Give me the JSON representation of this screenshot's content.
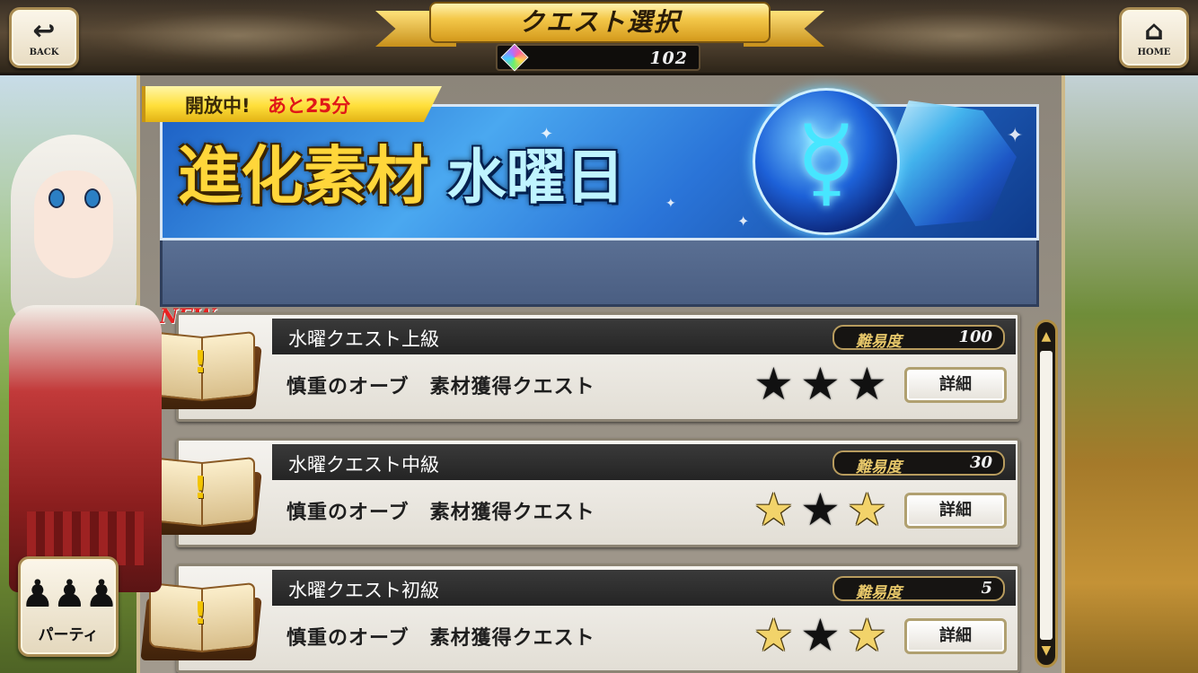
{
  "header": {
    "title": "クエスト選択",
    "back_label": "BACK",
    "home_label": "HOME",
    "gem_count": "102"
  },
  "event": {
    "open_status": "開放中!",
    "time_remaining": "あと25分",
    "title_main": "進化素材",
    "title_day": "水曜日",
    "orb_symbol": "☿"
  },
  "new_label": "NEW",
  "quests": [
    {
      "name": "水曜クエスト上級",
      "difficulty_label": "難易度",
      "difficulty": "100",
      "description": "慎重のオーブ　素材獲得クエスト",
      "stars": [
        "filled",
        "filled",
        "filled"
      ],
      "detail_label": "詳細"
    },
    {
      "name": "水曜クエスト中級",
      "difficulty_label": "難易度",
      "difficulty": "30",
      "description": "慎重のオーブ　素材獲得クエスト",
      "stars": [
        "gold",
        "filled",
        "gold"
      ],
      "detail_label": "詳細"
    },
    {
      "name": "水曜クエスト初級",
      "difficulty_label": "難易度",
      "difficulty": "5",
      "description": "慎重のオーブ　素材獲得クエスト",
      "stars": [
        "gold",
        "filled",
        "gold"
      ],
      "detail_label": "詳細"
    }
  ],
  "party": {
    "label": "パーティ"
  },
  "icons": {
    "back": "back-arrow-icon",
    "home": "home-icon",
    "gem": "rainbow-gem-icon",
    "book": "quest-book-icon",
    "star": "star-icon",
    "party": "party-members-icon"
  },
  "colors": {
    "title_gold": "#f4c84a",
    "event_blue": "#2a74d8",
    "open_tag_yellow": "#ffdf3a",
    "time_red": "#e01818",
    "header_dark": "#3a3025"
  }
}
